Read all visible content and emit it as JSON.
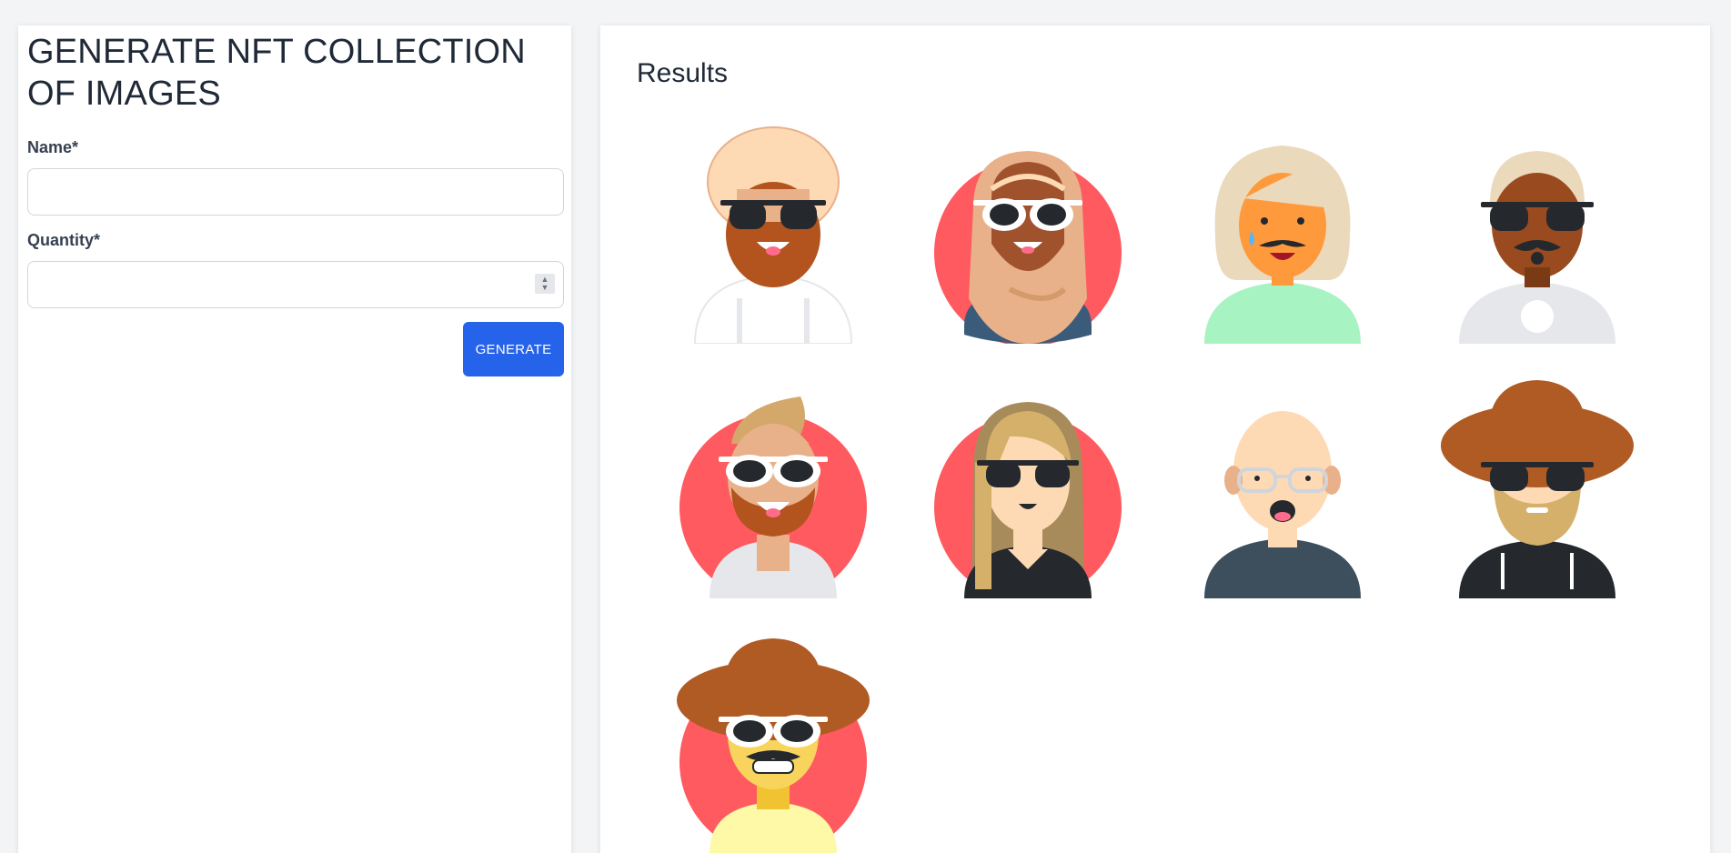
{
  "form": {
    "title": "GENERATE NFT COLLECTION OF IMAGES",
    "name_label": "Name*",
    "name_value": "",
    "quantity_label": "Quantity*",
    "quantity_value": "",
    "generate_label": "GENERATE"
  },
  "results": {
    "title": "Results",
    "avatars": [
      {
        "description": "turban-sunglasses-beard",
        "bg": "none",
        "skin": "#b3541e",
        "shirt": "#ffffff"
      },
      {
        "description": "hijab-white-sunglasses",
        "bg": "#ff5a5f",
        "skin": "#a0522d",
        "shirt": "#3b5b7a"
      },
      {
        "description": "blonde-bob-mustache-tear",
        "bg": "none",
        "skin": "#ff9a3c",
        "shirt": "#a7f3c2"
      },
      {
        "description": "grey-hair-sunglasses-mustache",
        "bg": "none",
        "skin": "#9a4a1f",
        "shirt": "#e5e7eb"
      },
      {
        "description": "quiff-white-sunglasses-beard",
        "bg": "#ff5a5f",
        "skin": "#e8b18a",
        "shirt": "#e5e7eb"
      },
      {
        "description": "long-blonde-hair-sunglasses",
        "bg": "#ff5a5f",
        "skin": "#fddab4",
        "shirt": "#25292e"
      },
      {
        "description": "bald-glasses-surprised",
        "bg": "none",
        "skin": "#fddab4",
        "shirt": "#3d4f5c"
      },
      {
        "description": "wide-hat-sunglasses-beard",
        "bg": "none",
        "skin": "#fddab4",
        "shirt": "#25292e"
      },
      {
        "description": "hat-white-sunglasses-mustache",
        "bg": "#ff5a5f",
        "skin": "#f8d45c",
        "shirt": "#fef9a6"
      }
    ]
  },
  "colors": {
    "primary_button": "#2563eb",
    "avatar_bg_red": "#ff5a5f",
    "page_bg": "#f3f4f6"
  }
}
